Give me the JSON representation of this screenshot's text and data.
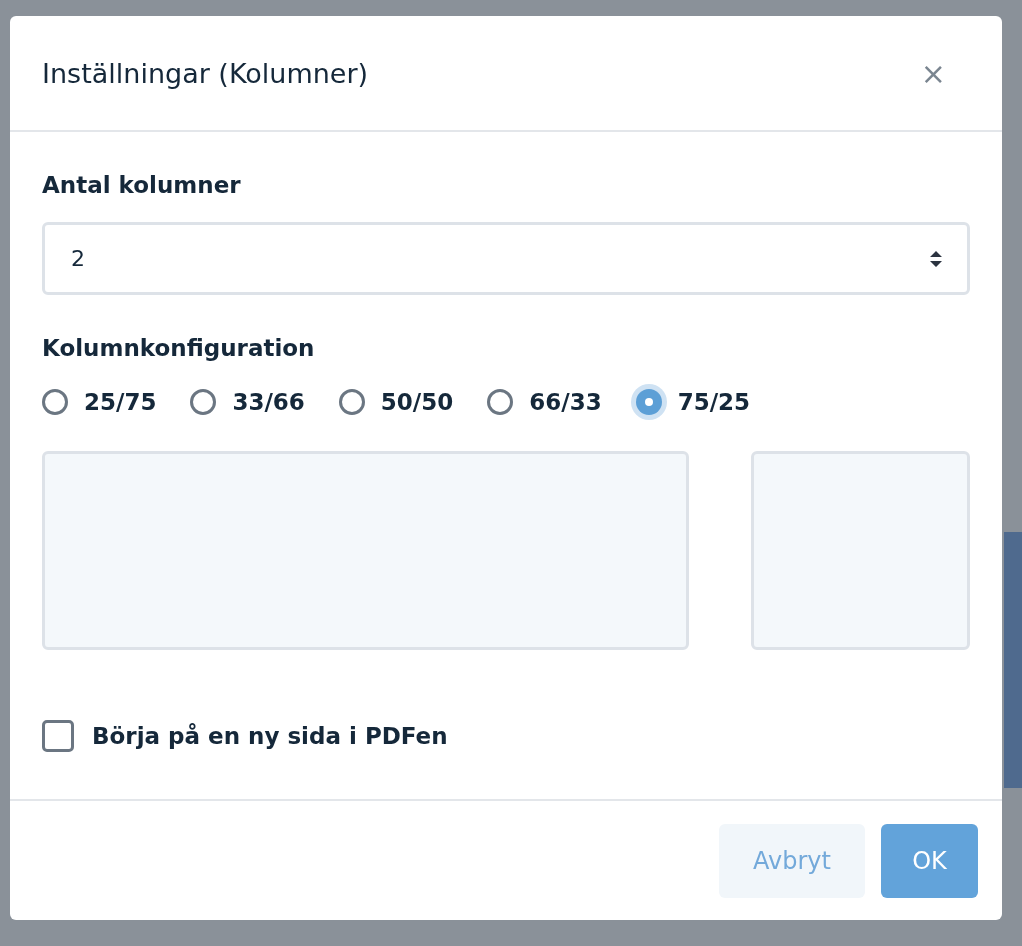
{
  "dialog": {
    "title": "Inställningar (Kolumner)",
    "close": "×"
  },
  "column_count": {
    "label": "Antal kolumner",
    "value": "2"
  },
  "column_config": {
    "label": "Kolumnkonfiguration",
    "options": [
      {
        "label": "25/75",
        "selected": false
      },
      {
        "label": "33/66",
        "selected": false
      },
      {
        "label": "50/50",
        "selected": false
      },
      {
        "label": "66/33",
        "selected": false
      },
      {
        "label": "75/25",
        "selected": true
      }
    ]
  },
  "new_page": {
    "label": "Börja på en ny sida i PDFen",
    "checked": false
  },
  "buttons": [
    {
      "label": "Avbryt",
      "kind": "secondary"
    },
    {
      "label": "OK",
      "kind": "primary"
    }
  ]
}
